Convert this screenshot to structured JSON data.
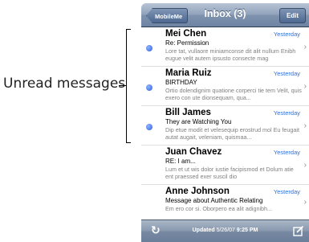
{
  "callout": {
    "label": "Unread messages"
  },
  "navbar": {
    "back_label": "MobileMe",
    "title": "Inbox (3)",
    "edit_label": "Edit"
  },
  "messages": [
    {
      "sender": "Mei Chen",
      "date": "Yesterday",
      "subject": "Re: Permission",
      "preview": "Lore tat, vullaore miniamconse dit alit nullum Enibh eugue velit autem ipsusto consecte mag",
      "unread": true
    },
    {
      "sender": "Maria Ruiz",
      "date": "Yesterday",
      "subject": "BIRTHDAY",
      "preview": "Ortio dolendignim quatione corperci tie tem Velit, quis exero con ute dionsequam, qua...",
      "unread": true
    },
    {
      "sender": "Bill James",
      "date": "Yesterday",
      "subject": "They are Watching You",
      "preview": "Dip etue modit et velesequip erostrud mol Eu feugait autat augait, veleniam, quismaa...",
      "unread": true
    },
    {
      "sender": "Juan Chavez",
      "date": "Yesterday",
      "subject": "RE: I am...",
      "preview": "Lum et ut wis dolor iustie facipismod et Dolum atie ent praessed exer suscil dio",
      "unread": false
    },
    {
      "sender": "Anne Johnson",
      "date": "Yesterday",
      "subject": "Message about Authentic Relating",
      "preview": "Em ero cor si. Oborpero ea alit adignibh...",
      "unread": false
    }
  ],
  "toolbar": {
    "updated_label": "Updated",
    "updated_date": "5/26/07",
    "updated_time": "9:25 PM"
  },
  "icons": {
    "refresh": "refresh-icon",
    "compose": "compose-icon",
    "chevron": "chevron-right-icon",
    "unread": "unread-dot-icon"
  },
  "colors": {
    "link_blue": "#2f6fd8",
    "unread_dot": "#2f62e0",
    "bar_blue": "#6d83a2"
  }
}
